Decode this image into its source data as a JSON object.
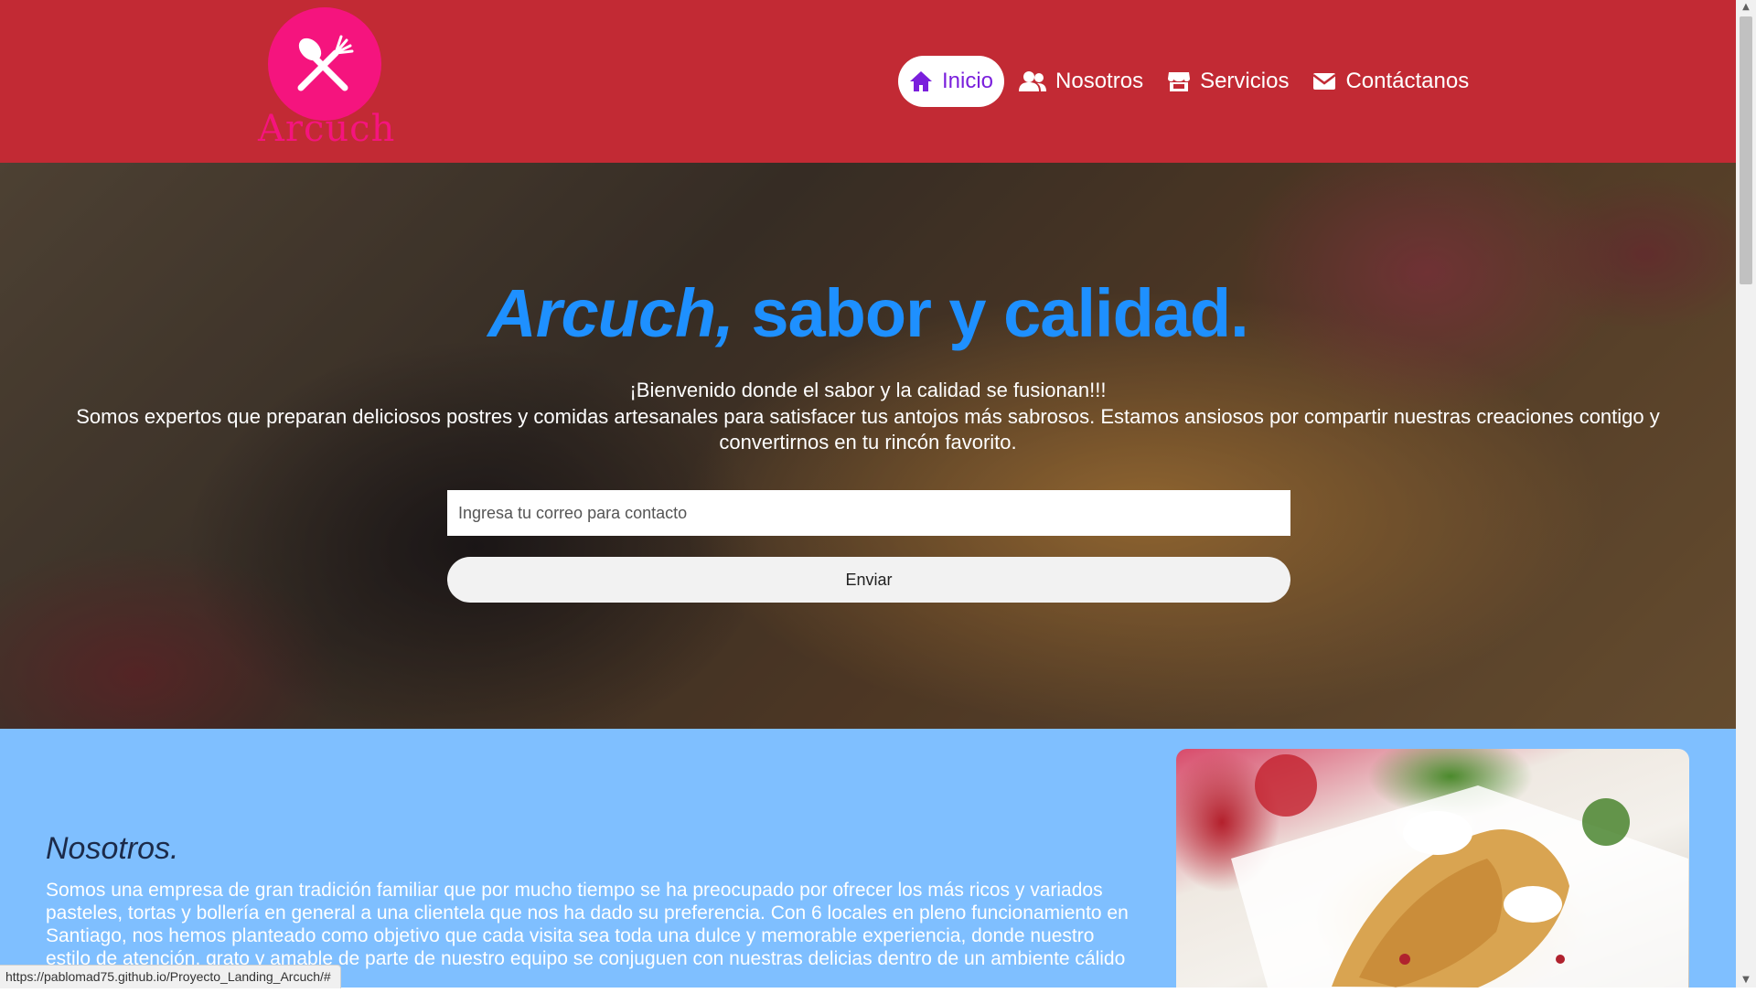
{
  "header": {
    "logo_text": "Arcuch",
    "nav": [
      {
        "label": "Inicio",
        "icon": "home-icon",
        "active": true
      },
      {
        "label": "Nosotros",
        "icon": "users-icon",
        "active": false
      },
      {
        "label": "Servicios",
        "icon": "store-icon",
        "active": false
      },
      {
        "label": "Contáctanos",
        "icon": "envelope-icon",
        "active": false
      }
    ]
  },
  "hero": {
    "title_brand": "Arcuch,",
    "title_rest": "sabor y calidad.",
    "welcome": "¡Bienvenido donde el sabor y la calidad se fusionan!!!",
    "description": "Somos expertos que preparan deliciosos postres y comidas artesanales para satisfacer tus antojos más sabrosos. Estamos ansiosos por compartir nuestras creaciones contigo y convertirnos en tu rincón favorito.",
    "email_placeholder": "Ingresa tu correo para contacto",
    "email_value": "",
    "submit_label": "Enviar"
  },
  "about": {
    "title": "Nosotros.",
    "text": "Somos una empresa de gran tradición familiar que por mucho tiempo se ha preocupado por ofrecer los más ricos y variados pasteles, tortas y bollería en general a una clientela que nos ha dado su preferencia. Con 6 locales en pleno funcionamiento en Santiago, nos hemos planteado como objetivo que cada visita sea toda una dulce y memorable experiencia, donde nuestro estilo de atención, grato y amable de parte de nuestro equipo se conjuguen con nuestras delicias dentro de un ambiente cálido y acogedor."
  },
  "status_bar": {
    "url": "https://pablomad75.github.io/Proyecto_Landing_Arcuch/#"
  },
  "colors": {
    "header_bg": "#c22a34",
    "logo_pink": "#f5147e",
    "nav_active_text": "#7a1fdc",
    "title_blue": "#1e90ff",
    "about_bg": "#7fbfff"
  }
}
